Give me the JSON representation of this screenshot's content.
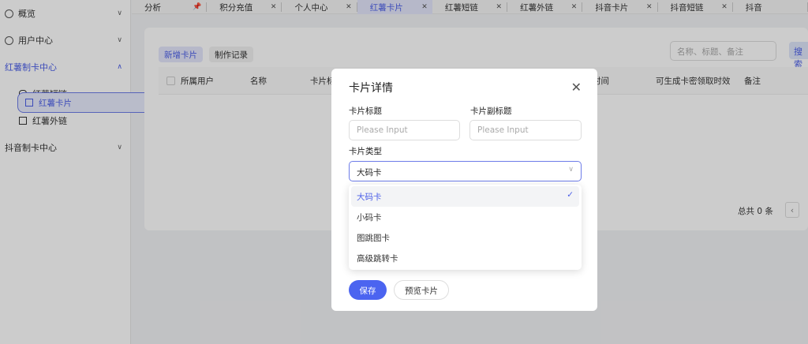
{
  "sidebar": {
    "items": [
      {
        "label": "概览",
        "icon": "dashboard-icon",
        "expanded": false
      },
      {
        "label": "用户中心",
        "icon": "user-icon",
        "expanded": false
      },
      {
        "label": "红薯制卡中心",
        "icon": "card-icon",
        "expanded": true,
        "children": [
          {
            "label": "红薯卡片",
            "icon": "list-icon",
            "selected": true
          },
          {
            "label": "红薯短链",
            "icon": "link-icon"
          },
          {
            "label": "红薯外链",
            "icon": "external-link-icon"
          }
        ]
      },
      {
        "label": "抖音制卡中心",
        "icon": "card-icon",
        "expanded": false
      }
    ]
  },
  "tabs": [
    {
      "label": "分析",
      "pinned": true
    },
    {
      "label": "积分充值"
    },
    {
      "label": "个人中心"
    },
    {
      "label": "红薯卡片",
      "active": true
    },
    {
      "label": "红薯短链"
    },
    {
      "label": "红薯外链"
    },
    {
      "label": "抖音卡片"
    },
    {
      "label": "抖音短链"
    },
    {
      "label": "抖音"
    }
  ],
  "main": {
    "tab_new": "新增卡片",
    "tab_records": "制作记录",
    "search_placeholder": "名称、标题、备注",
    "search_button": "搜索",
    "columns": [
      "所属用户",
      "名称",
      "卡片标",
      "时间",
      "可生成卡密领取时效",
      "备注"
    ],
    "total": "总共 0 条"
  },
  "modal": {
    "title": "卡片详情",
    "card_title_label": "卡片标题",
    "card_title_placeholder": "Please Input",
    "card_subtitle_label": "卡片副标题",
    "card_subtitle_placeholder": "Please Input",
    "card_type_label": "卡片类型",
    "card_type_value": "大码卡",
    "options": [
      "大码卡",
      "小码卡",
      "图跳图卡",
      "高级跳转卡"
    ],
    "save": "保存",
    "preview": "预览卡片"
  },
  "colors": {
    "accent": "#4b64f0"
  }
}
